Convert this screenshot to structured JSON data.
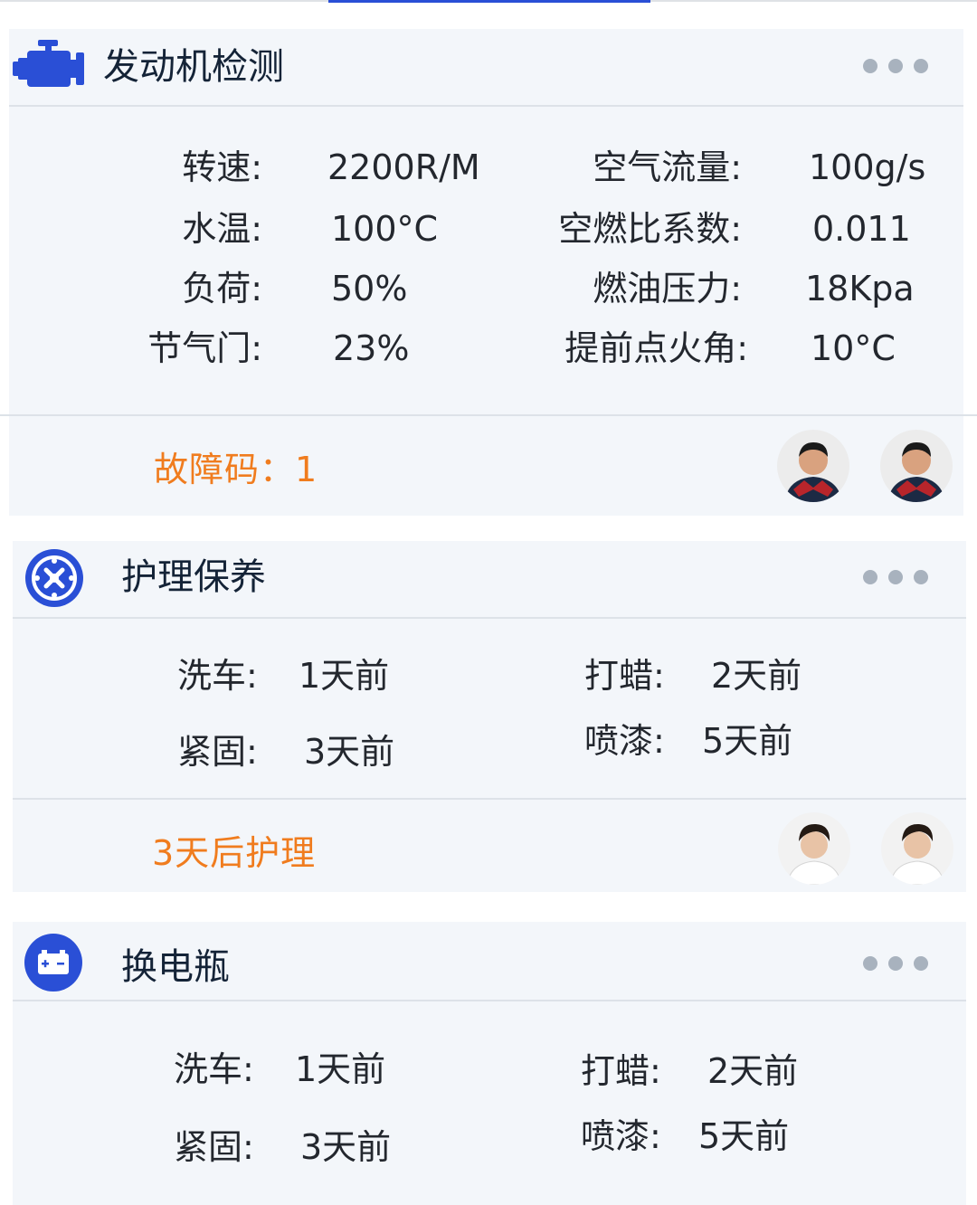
{
  "colors": {
    "accent": "#2a4fd6",
    "warning": "#f07c1e",
    "card_bg": "#f3f6fa"
  },
  "engine": {
    "title": "发动机检测",
    "icon": "engine-icon",
    "stats_left": [
      {
        "label": "转速:",
        "value": "2200R/M"
      },
      {
        "label": "水温:",
        "value": "100°C"
      },
      {
        "label": "负荷:",
        "value": "50%"
      },
      {
        "label": "节气门:",
        "value": "23%"
      }
    ],
    "stats_right": [
      {
        "label": "空气流量:",
        "value": "100g/s"
      },
      {
        "label": "空燃比系数:",
        "value": "0.011"
      },
      {
        "label": "燃油压力:",
        "value": "18Kpa"
      },
      {
        "label": "提前点火角:",
        "value": "10°C"
      }
    ],
    "footer": "故障码：1"
  },
  "maintenance": {
    "title": "护理保养",
    "icon": "wheel-icon",
    "items": [
      {
        "label": "洗车:",
        "value": "1天前"
      },
      {
        "label": "打蜡:",
        "value": "2天前"
      },
      {
        "label": "紧固:",
        "value": "3天前"
      },
      {
        "label": "喷漆:",
        "value": "5天前"
      }
    ],
    "footer": "3天后护理"
  },
  "battery": {
    "title": "换电瓶",
    "icon": "battery-icon",
    "items": [
      {
        "label": "洗车:",
        "value": "1天前"
      },
      {
        "label": "打蜡:",
        "value": "2天前"
      },
      {
        "label": "紧固:",
        "value": "3天前"
      },
      {
        "label": "喷漆:",
        "value": "5天前"
      }
    ]
  }
}
